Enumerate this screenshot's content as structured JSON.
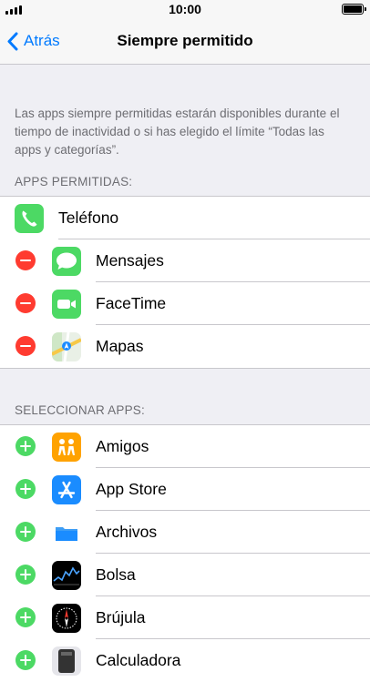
{
  "status_bar": {
    "time": "10:00"
  },
  "nav": {
    "back_label": "Atrás",
    "title": "Siempre permitido"
  },
  "description": "Las apps siempre permitidas estarán disponibles durante el tiempo de inactividad o si has elegido el límite “Todas las apps y categorías”.",
  "allowed": {
    "header": "APPS PERMITIDAS:",
    "apps": [
      {
        "name": "Teléfono",
        "icon": "phone-icon",
        "color": "#4cd964"
      },
      {
        "name": "Mensajes",
        "icon": "messages-icon",
        "color": "#4cd964"
      },
      {
        "name": "FaceTime",
        "icon": "facetime-icon",
        "color": "#4cd964"
      },
      {
        "name": "Mapas",
        "icon": "maps-icon",
        "color": "#e9f0e6"
      }
    ]
  },
  "select": {
    "header": "SELECCIONAR APPS:",
    "apps": [
      {
        "name": "Amigos",
        "icon": "find-friends-icon",
        "color": "#ffa200"
      },
      {
        "name": "App Store",
        "icon": "app-store-icon",
        "color": "#1a8cff"
      },
      {
        "name": "Archivos",
        "icon": "files-icon",
        "color": "#ffffff"
      },
      {
        "name": "Bolsa",
        "icon": "stocks-icon",
        "color": "#000000"
      },
      {
        "name": "Brújula",
        "icon": "compass-icon",
        "color": "#000000"
      },
      {
        "name": "Calculadora",
        "icon": "calculator-icon",
        "color": "#e5e5ea"
      }
    ]
  },
  "colors": {
    "accent": "#007aff",
    "remove": "#ff3b30",
    "add": "#4cd964"
  }
}
